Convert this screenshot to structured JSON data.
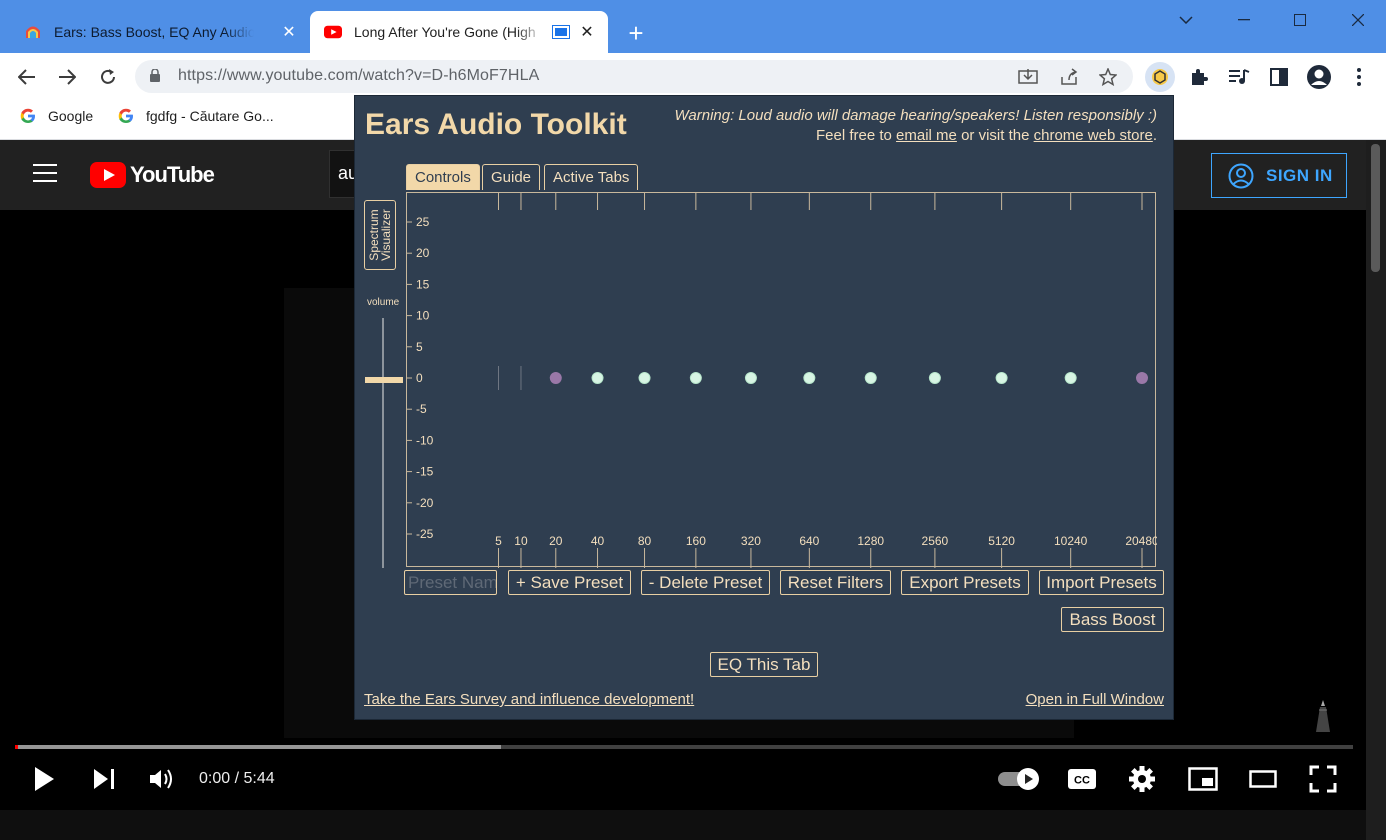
{
  "browser": {
    "tabs": [
      {
        "title": "Ears: Bass Boost, EQ Any Audio! - Chr",
        "active": false
      },
      {
        "title": "Long After You're Gone (High",
        "active": true
      }
    ],
    "url": "https://www.youtube.com/watch?v=D-h6MoF7HLA",
    "bookmarks": [
      {
        "label": "Google"
      },
      {
        "label": "fgdfg - Căutare Go..."
      }
    ]
  },
  "youtube": {
    "logo_text": "YouTube",
    "search_value": "au",
    "sign_in": "SIGN IN",
    "time": "0:00 / 5:44",
    "progress_loaded": 0.363
  },
  "ears": {
    "title": "Ears Audio Toolkit",
    "warning": "Warning: Loud audio will damage hearing/speakers! Listen responsibly :)",
    "feel_free": "Feel free to",
    "email_link": "email me",
    "or_visit": "or visit the",
    "store_link": "chrome web store",
    "period": ".",
    "tabs": [
      "Controls",
      "Guide",
      "Active Tabs"
    ],
    "selected_tab": "Controls",
    "spectrum_line1": "Spectrum",
    "spectrum_line2": "Visualizer",
    "volume_label": "volume",
    "preset_placeholder": "Preset Name",
    "buttons": {
      "save": "+ Save Preset",
      "delete": "- Delete Preset",
      "reset": "Reset Filters",
      "export": "Export Presets",
      "import": "Import Presets",
      "bass": "Bass Boost",
      "eq_tab": "EQ This Tab"
    },
    "survey_link": "Take the Ears Survey and influence development!",
    "full_window_link": "Open in Full Window",
    "colors": {
      "panel": "#2f3e50",
      "accent": "#f2d8a9",
      "node": "#d8f5e4",
      "node_edge": "#9a78a8"
    }
  },
  "chart_data": {
    "type": "scatter",
    "x_ticks": [
      5,
      10,
      20,
      40,
      80,
      160,
      320,
      640,
      1280,
      2560,
      5120,
      10240,
      20480
    ],
    "y_ticks": [
      25,
      20,
      15,
      10,
      5,
      0,
      -5,
      -10,
      -15,
      -20,
      -25
    ],
    "ylim": [
      -25,
      25
    ],
    "x_scale": "log",
    "nodes": [
      {
        "freq": 20,
        "gain": 0,
        "kind": "edge"
      },
      {
        "freq": 40,
        "gain": 0,
        "kind": "band"
      },
      {
        "freq": 80,
        "gain": 0,
        "kind": "band"
      },
      {
        "freq": 160,
        "gain": 0,
        "kind": "band"
      },
      {
        "freq": 320,
        "gain": 0,
        "kind": "band"
      },
      {
        "freq": 640,
        "gain": 0,
        "kind": "band"
      },
      {
        "freq": 1280,
        "gain": 0,
        "kind": "band"
      },
      {
        "freq": 2560,
        "gain": 0,
        "kind": "band"
      },
      {
        "freq": 5120,
        "gain": 0,
        "kind": "band"
      },
      {
        "freq": 10240,
        "gain": 0,
        "kind": "band"
      },
      {
        "freq": 20480,
        "gain": 0,
        "kind": "edge"
      }
    ]
  }
}
